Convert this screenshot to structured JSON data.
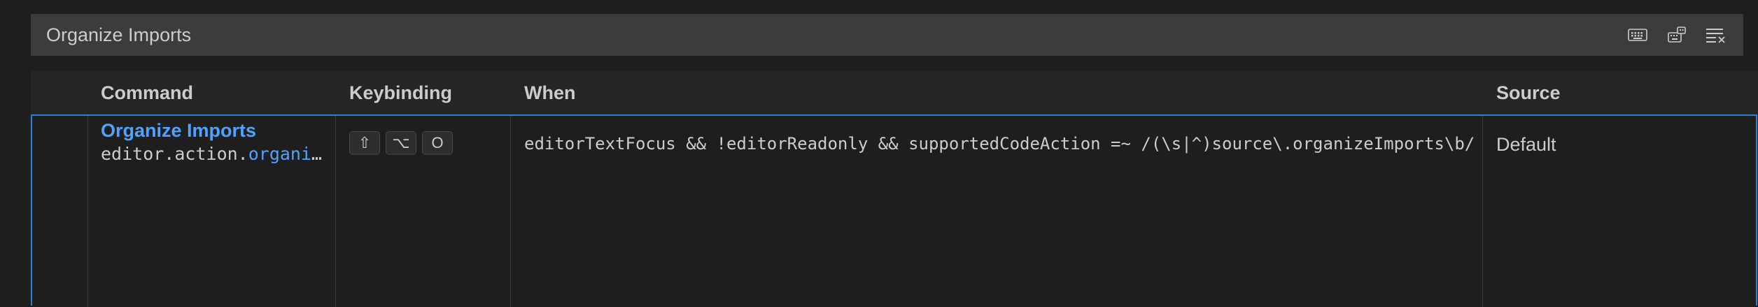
{
  "search": {
    "value": "Organize Imports"
  },
  "toolbar": {
    "icons": [
      "keyboard-icon",
      "record-keys-icon",
      "clear-search-icon"
    ]
  },
  "table": {
    "headers": {
      "command": "Command",
      "keybinding": "Keybinding",
      "when": "When",
      "source": "Source"
    },
    "rows": [
      {
        "title": "Organize Imports",
        "command_id_prefix": "editor.action.",
        "command_id_match": "organize…",
        "keys": [
          "⇧",
          "⌥",
          "O"
        ],
        "when": "editorTextFocus && !editorReadonly && supportedCodeAction =~ /(\\s|^)source\\.organizeImports\\b/",
        "source": "Default"
      }
    ]
  },
  "colors": {
    "accent": "#4fa3ff",
    "selection_border": "#2f7fd6",
    "background": "#1e1e1e",
    "input_background": "#3c3c3c"
  }
}
